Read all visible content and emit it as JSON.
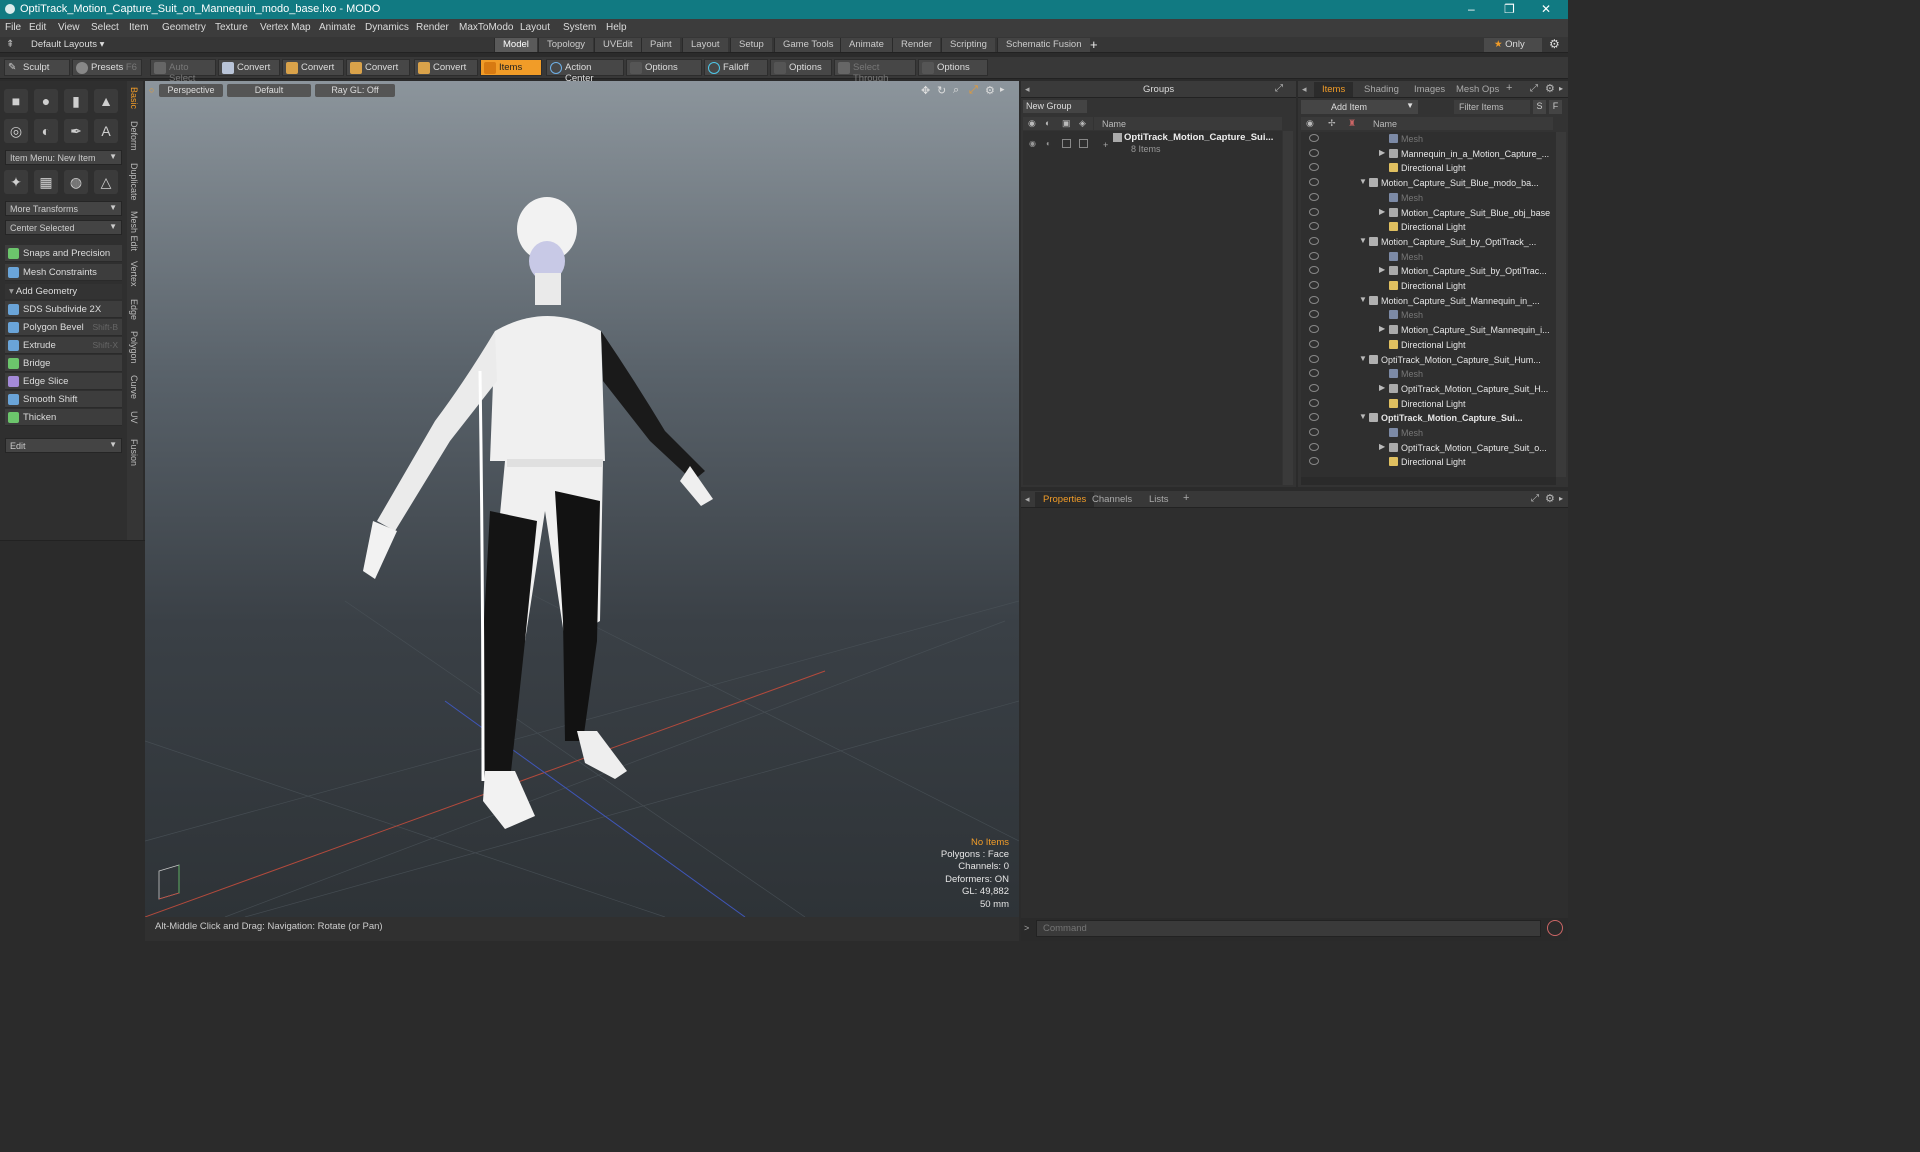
{
  "window": {
    "title": "OptiTrack_Motion_Capture_Suit_on_Mannequin_modo_base.lxo - MODO",
    "minimize": "–",
    "restore": "❐",
    "close": "✕"
  },
  "menubar": {
    "items": [
      "File",
      "Edit",
      "View",
      "Select",
      "Item",
      "Geometry",
      "Texture",
      "Vertex Map",
      "Animate",
      "Dynamics",
      "Render",
      "MaxToModo",
      "Layout",
      "System",
      "Help"
    ]
  },
  "layoutbar": {
    "default_layouts": "Default Layouts ▾",
    "tabs": [
      "Model",
      "Topology",
      "UVEdit",
      "Paint",
      "Layout",
      "Setup",
      "Game Tools",
      "Animate",
      "Render",
      "Scripting",
      "Schematic Fusion"
    ],
    "active_tab": "Model",
    "add": "+",
    "only": "Only"
  },
  "toolbar": {
    "sculpt": "Sculpt",
    "presets": "Presets",
    "presets_key": "F6",
    "auto_select": "Auto Select",
    "convert": "Convert",
    "items": "Items",
    "action_center": "Action Center",
    "options": "Options",
    "falloff": "Falloff",
    "select_through": "Select Through"
  },
  "leftpanel": {
    "item_menu": "Item Menu: New Item",
    "more_transforms": "More Transforms",
    "center_selected": "Center Selected",
    "snaps": "Snaps and Precision",
    "mesh_constraints": "Mesh Constraints",
    "add_geometry": "Add Geometry",
    "tools": [
      {
        "label": "SDS Subdivide 2X",
        "key": ""
      },
      {
        "label": "Polygon Bevel",
        "key": "Shift-B"
      },
      {
        "label": "Extrude",
        "key": "Shift-X"
      },
      {
        "label": "Bridge",
        "key": ""
      },
      {
        "label": "Edge Slice",
        "key": ""
      },
      {
        "label": "Smooth Shift",
        "key": ""
      },
      {
        "label": "Thicken",
        "key": ""
      }
    ],
    "edit": "Edit",
    "vtabs": [
      "Basic",
      "Deform",
      "Duplicate",
      "Mesh Edit",
      "Vertex",
      "Edge",
      "Polygon",
      "Curve",
      "UV",
      "Fusion"
    ]
  },
  "viewport": {
    "perspective": "Perspective",
    "default": "Default",
    "raygl": "Ray GL: Off",
    "hud": {
      "no_items": "No Items",
      "polygons": "Polygons : Face",
      "channels": "Channels: 0",
      "deformers": "Deformers: ON",
      "gl": "GL: 49,882",
      "focal": "50 mm"
    }
  },
  "statusbar": {
    "text": "Alt-Middle Click and Drag:   Navigation: Rotate (or Pan)"
  },
  "groups": {
    "title": "Groups",
    "new_group": "New Group",
    "name_col": "Name",
    "group_name": "OptiTrack_Motion_Capture_Sui...",
    "group_count": "8 Items"
  },
  "items_panel": {
    "tabs": [
      "Items",
      "Shading",
      "Images",
      "Mesh Ops"
    ],
    "add_item": "Add Item",
    "filter": "Filter Items",
    "s": "S",
    "f": "F",
    "name_col": "Name",
    "rows": [
      {
        "label": "Mesh",
        "indent": 2,
        "type": "mesh"
      },
      {
        "label": "Mannequin_in_a_Motion_Capture_...",
        "indent": 2,
        "type": "obj",
        "tri": true
      },
      {
        "label": "Directional Light",
        "indent": 2,
        "type": "light"
      },
      {
        "label": "Motion_Capture_Suit_Blue_modo_ba...",
        "indent": 1,
        "type": "scene",
        "tri": true
      },
      {
        "label": "Mesh",
        "indent": 2,
        "type": "mesh"
      },
      {
        "label": "Motion_Capture_Suit_Blue_obj_base",
        "indent": 2,
        "type": "obj",
        "tri": true
      },
      {
        "label": "Directional Light",
        "indent": 2,
        "type": "light"
      },
      {
        "label": "Motion_Capture_Suit_by_OptiTrack_...",
        "indent": 1,
        "type": "scene",
        "tri": true
      },
      {
        "label": "Mesh",
        "indent": 2,
        "type": "mesh"
      },
      {
        "label": "Motion_Capture_Suit_by_OptiTrac...",
        "indent": 2,
        "type": "obj",
        "tri": true
      },
      {
        "label": "Directional Light",
        "indent": 2,
        "type": "light"
      },
      {
        "label": "Motion_Capture_Suit_Mannequin_in_...",
        "indent": 1,
        "type": "scene",
        "tri": true
      },
      {
        "label": "Mesh",
        "indent": 2,
        "type": "mesh"
      },
      {
        "label": "Motion_Capture_Suit_Mannequin_i...",
        "indent": 2,
        "type": "obj",
        "tri": true
      },
      {
        "label": "Directional Light",
        "indent": 2,
        "type": "light"
      },
      {
        "label": "OptiTrack_Motion_Capture_Suit_Hum...",
        "indent": 1,
        "type": "scene",
        "tri": true
      },
      {
        "label": "Mesh",
        "indent": 2,
        "type": "mesh"
      },
      {
        "label": "OptiTrack_Motion_Capture_Suit_H...",
        "indent": 2,
        "type": "obj",
        "tri": true
      },
      {
        "label": "Directional Light",
        "indent": 2,
        "type": "light"
      },
      {
        "label": "OptiTrack_Motion_Capture_Sui...",
        "indent": 1,
        "type": "scene",
        "tri": true,
        "bold": true
      },
      {
        "label": "Mesh",
        "indent": 2,
        "type": "mesh"
      },
      {
        "label": "OptiTrack_Motion_Capture_Suit_o...",
        "indent": 2,
        "type": "obj",
        "tri": true
      },
      {
        "label": "Directional Light",
        "indent": 2,
        "type": "light"
      }
    ]
  },
  "props": {
    "tabs": [
      "Properties",
      "Channels",
      "Lists"
    ],
    "add": "+"
  },
  "cmd": {
    "placeholder": "Command"
  },
  "colors": {
    "accent": "#f19c28",
    "titlebar": "#117a82"
  }
}
